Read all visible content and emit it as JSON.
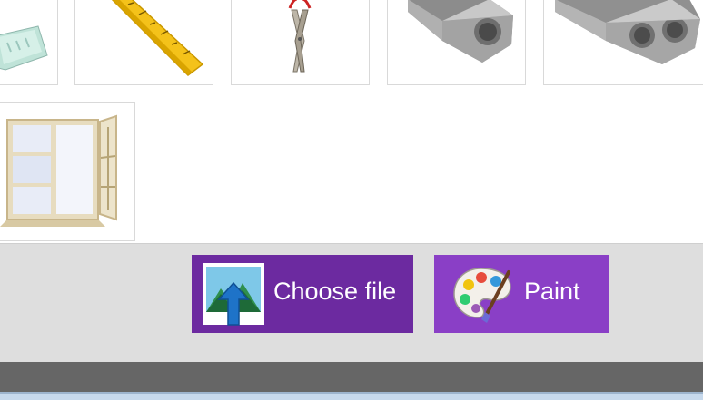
{
  "gallery": {
    "items": [
      {
        "icon": "eraser-icon"
      },
      {
        "icon": "ruler-icon"
      },
      {
        "icon": "scissors-icon"
      },
      {
        "icon": "pencil-sharpener-icon"
      },
      {
        "icon": "double-pencil-sharpener-icon"
      },
      {
        "icon": "window-icon"
      }
    ]
  },
  "toolbar": {
    "choose_file_label": "Choose file",
    "choose_file_icon": "upload-image-icon",
    "paint_label": "Paint",
    "paint_icon": "paint-palette-icon"
  },
  "colors": {
    "choose_file_bg": "#6c2aa0",
    "paint_bg": "#8a3fc6",
    "toolbar_bg": "#dedede",
    "bottom_bar": "#666666"
  }
}
